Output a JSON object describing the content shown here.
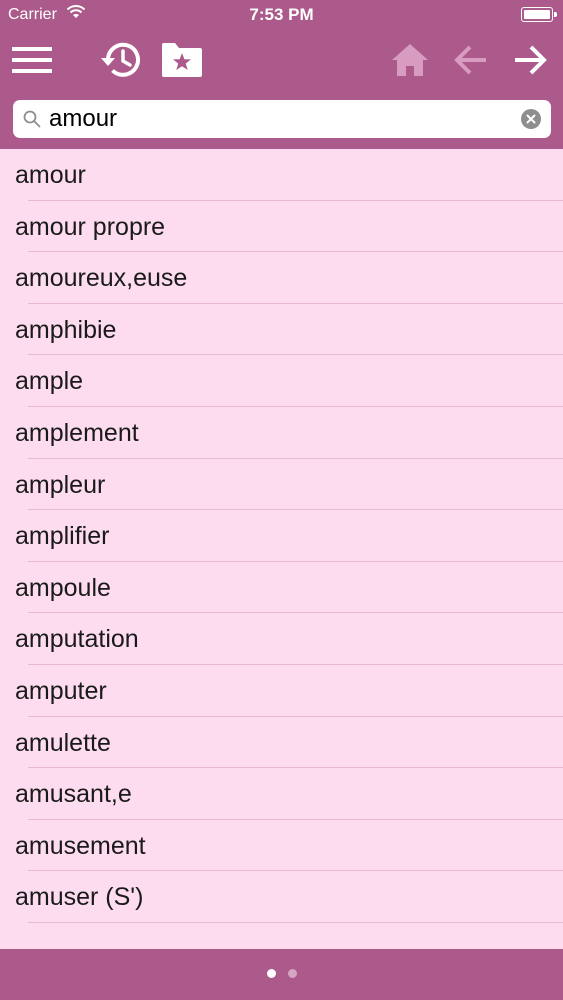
{
  "status": {
    "carrier": "Carrier",
    "time": "7:53 PM"
  },
  "toolbar": {
    "menu_icon": "hamburger-menu-icon",
    "history_icon": "history-clock-icon",
    "favorites_icon": "folder-star-icon",
    "home_icon": "home-icon",
    "back_icon": "arrow-left-icon",
    "forward_icon": "arrow-right-icon"
  },
  "search": {
    "value": "amour",
    "placeholder": ""
  },
  "words": [
    "amour",
    "amour propre",
    "amoureux,euse",
    "amphibie",
    "ample",
    "amplement",
    "ampleur",
    "amplifier",
    "ampoule",
    "amputation",
    "amputer",
    "amulette",
    "amusant,e",
    "amusement",
    "amuser (S')"
  ],
  "pager": {
    "pages": 2,
    "current": 1
  },
  "colors": {
    "header": "#ab5a8b",
    "list_background": "#fddcef",
    "separator": "#e7b9d3"
  }
}
